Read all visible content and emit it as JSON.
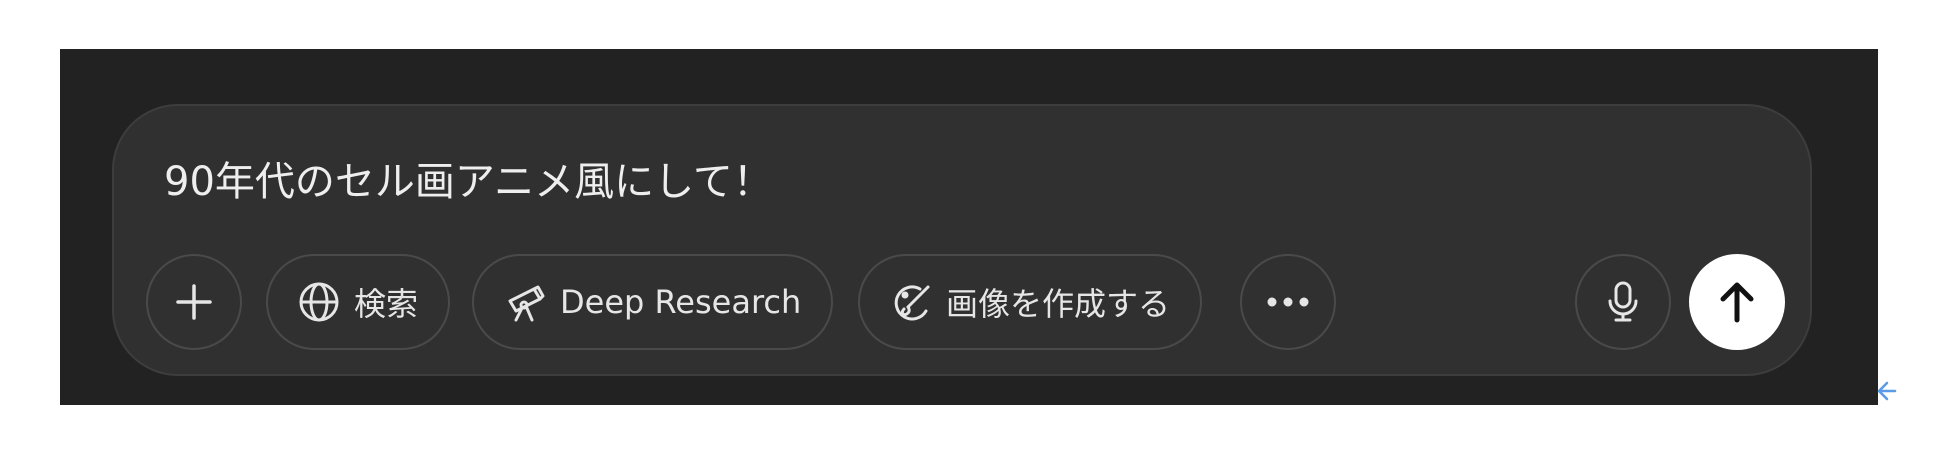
{
  "composer": {
    "prompt_text": "90年代のセル画アニメ風にして！"
  },
  "toolbar": {
    "add_icon": "plus-icon",
    "search_label": "検索",
    "search_icon": "globe-icon",
    "deep_research_label": "Deep Research",
    "deep_research_icon": "telescope-icon",
    "create_image_label": "画像を作成する",
    "create_image_icon": "palette-icon",
    "more_icon": "ellipsis-icon",
    "mic_icon": "microphone-icon",
    "send_icon": "arrow-up-icon"
  },
  "colors": {
    "panel_bg": "#222222",
    "composer_bg": "#303030",
    "border": "#4a4a4a",
    "text": "#eeeeee",
    "send_bg": "#ffffff",
    "corner_arrow": "#5a9ae6"
  }
}
